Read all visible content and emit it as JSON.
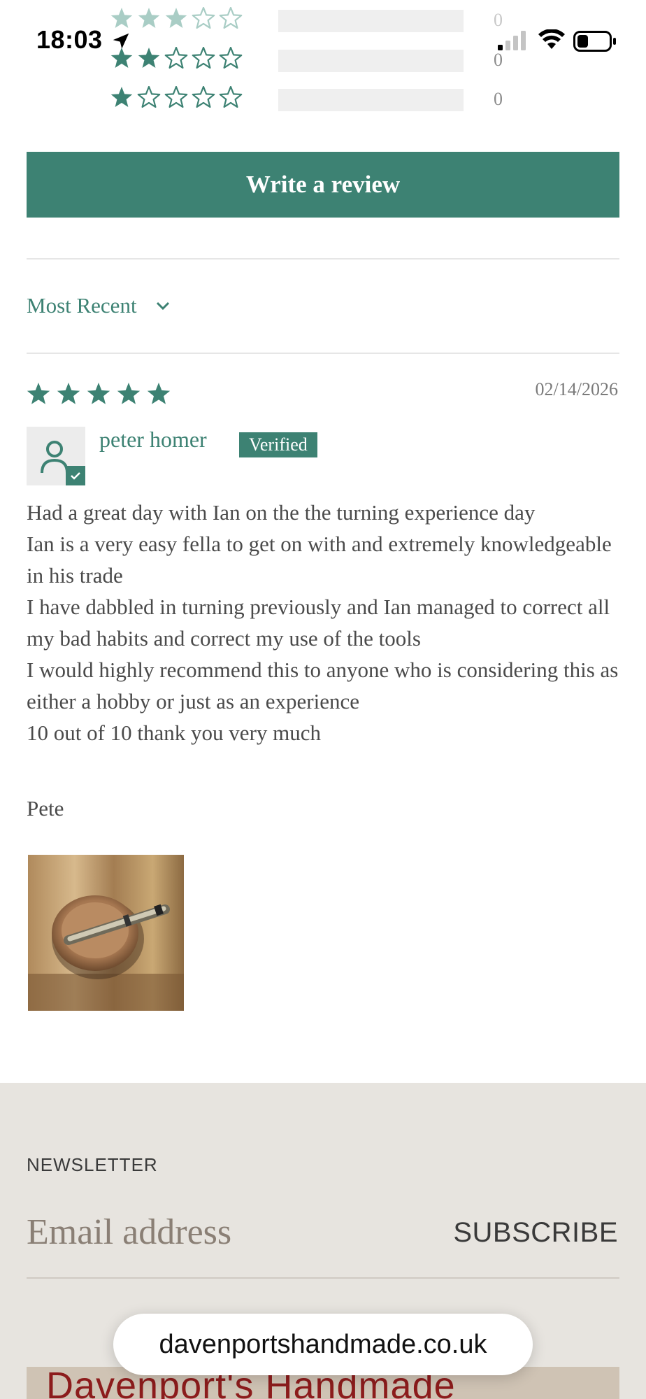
{
  "status_bar": {
    "time": "18:03"
  },
  "rating_breakdown": [
    {
      "stars": 3,
      "count": "0"
    },
    {
      "stars": 2,
      "count": "0"
    },
    {
      "stars": 1,
      "count": "0"
    }
  ],
  "write_review_label": "Write a review",
  "sort": {
    "selected": "Most Recent"
  },
  "review": {
    "rating": 5,
    "date": "02/14/2026",
    "author": "peter homer",
    "badge": "Verified",
    "body": [
      "Had a great day with Ian on the the turning experience day",
      "Ian is a very easy fella to get on with and extremely knowledgeable in his trade",
      "I have dabbled in turning previously and Ian managed to correct all my bad habits and correct my use of the tools",
      "I would highly recommend this to anyone who is considering this as either a hobby or just as an experience",
      "10 out of 10 thank you very much"
    ],
    "signature": "Pete"
  },
  "footer": {
    "newsletter_label": "NEWSLETTER",
    "email_placeholder": "Email address",
    "subscribe_label": "SUBSCRIBE",
    "logo_text": "Davenport's Handmade"
  },
  "browser": {
    "url": "davenportshandmade.co.uk"
  },
  "colors": {
    "accent": "#3d8273",
    "footer_bg": "#e7e4df",
    "bar_bg": "#efefef"
  }
}
